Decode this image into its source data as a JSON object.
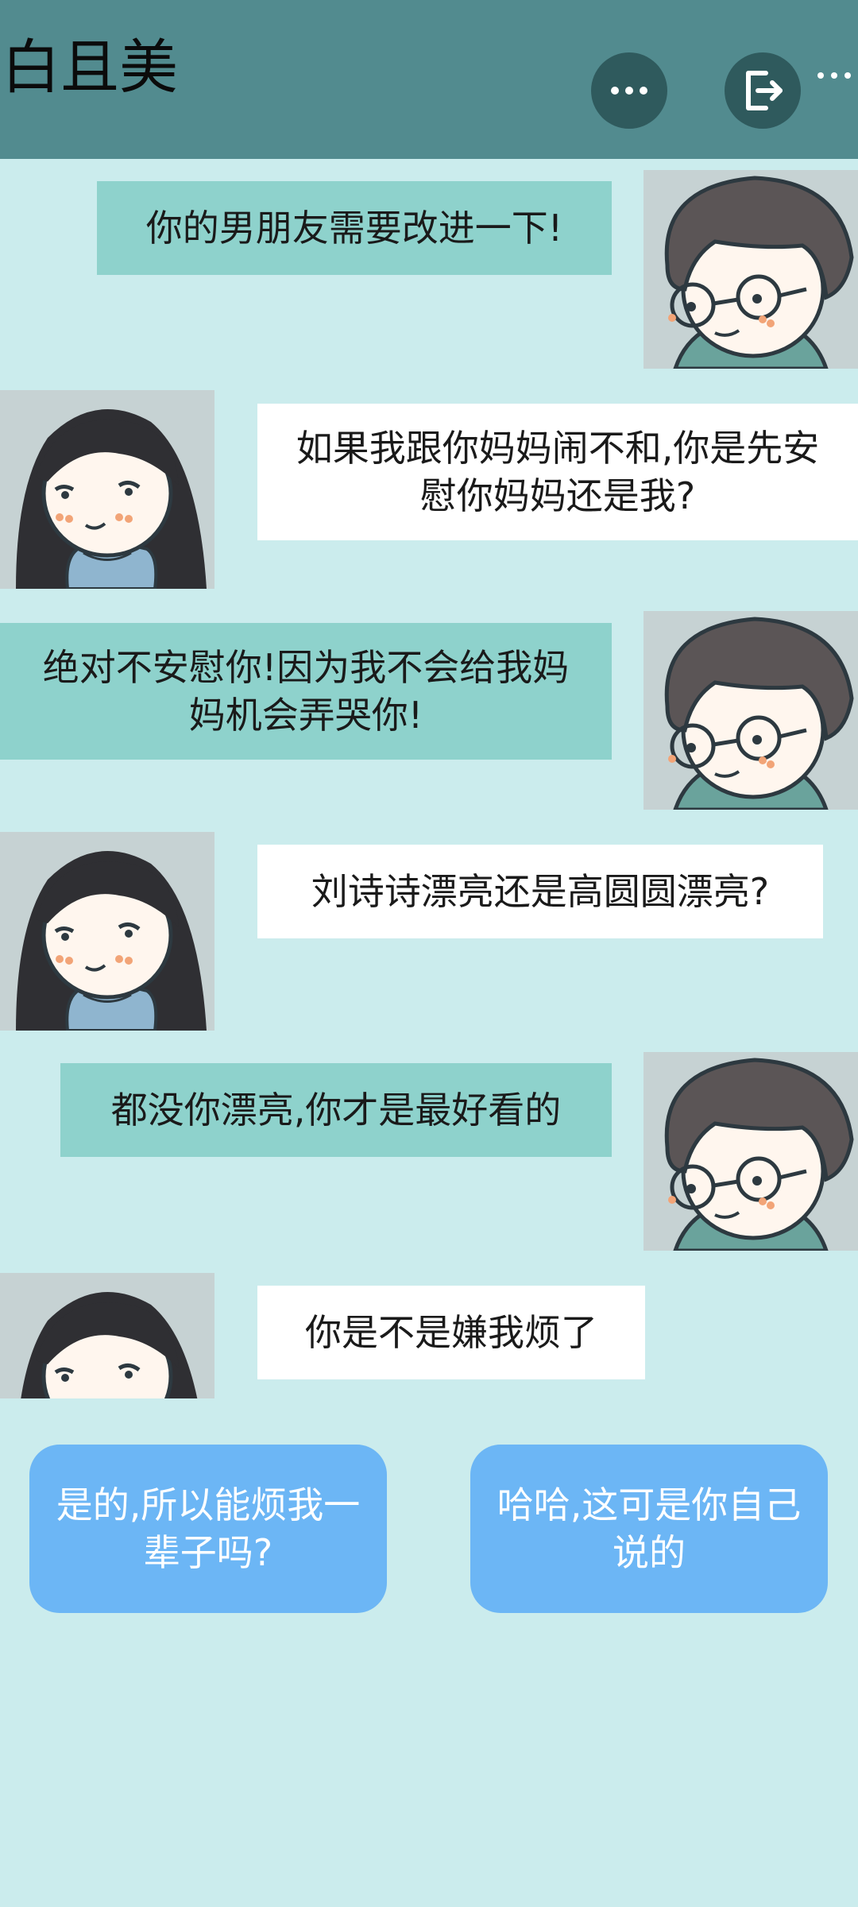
{
  "header": {
    "title": "白且美",
    "more_icon": "more-horizontal-icon",
    "exit_icon": "exit-icon",
    "colors": {
      "bar": "#528b8f",
      "button": "#2f5a5d"
    }
  },
  "messages": [
    {
      "sender": "boy",
      "text": "你的男朋友需要改进一下!"
    },
    {
      "sender": "girl",
      "text": "如果我跟你妈妈闹不和,你是先安慰你妈妈还是我?"
    },
    {
      "sender": "boy",
      "text": "绝对不安慰你!因为我不会给我妈妈机会弄哭你!"
    },
    {
      "sender": "girl",
      "text": "刘诗诗漂亮还是高圆圆漂亮?"
    },
    {
      "sender": "boy",
      "text": "都没你漂亮,你才是最好看的"
    },
    {
      "sender": "girl",
      "text": "你是不是嫌我烦了"
    }
  ],
  "choices": [
    {
      "text": "是的,所以能烦我一辈子吗?"
    },
    {
      "text": "哈哈,这可是你自己说的"
    }
  ],
  "colors": {
    "background": "#cbeced",
    "boy_bubble": "#8ed2cc",
    "girl_bubble": "#ffffff",
    "choice_button": "#6cb6f5"
  }
}
